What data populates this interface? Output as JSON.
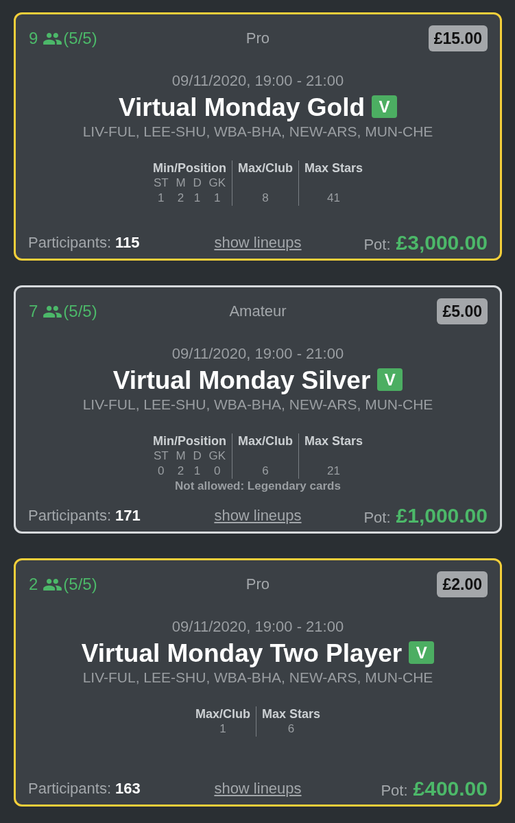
{
  "contests": [
    {
      "color": "#f4cf3a",
      "entries": "9",
      "slots": "(5/5)",
      "tier": "Pro",
      "fee": "£15.00",
      "schedule": "09/11/2020, 19:00 - 21:00",
      "title": "Virtual Monday Gold",
      "badge": "V",
      "fixtures": "LIV-FUL, LEE-SHU, WBA-BHA, NEW-ARS, MUN-CHE",
      "rules": [
        {
          "kind": "positions",
          "heading": "Min/Position",
          "positions": [
            {
              "label": "ST",
              "value": "1"
            },
            {
              "label": "M",
              "value": "2"
            },
            {
              "label": "D",
              "value": "1"
            },
            {
              "label": "GK",
              "value": "1"
            }
          ]
        },
        {
          "kind": "single",
          "heading": "Max/Club",
          "value": "8"
        },
        {
          "kind": "single",
          "heading": "Max Stars",
          "value": "41"
        }
      ],
      "participants_label": "Participants:",
      "participants": "115",
      "link": "show lineups",
      "pot_label": "Pot:",
      "pot": "£3,000.00"
    },
    {
      "color": "#d7dadd",
      "entries": "7",
      "slots": "(5/5)",
      "tier": "Amateur",
      "fee": "£5.00",
      "schedule": "09/11/2020, 19:00 - 21:00",
      "title": "Virtual Monday Silver",
      "badge": "V",
      "fixtures": "LIV-FUL, LEE-SHU, WBA-BHA, NEW-ARS, MUN-CHE",
      "rules": [
        {
          "kind": "positions",
          "heading": "Min/Position",
          "positions": [
            {
              "label": "ST",
              "value": "0"
            },
            {
              "label": "M",
              "value": "2"
            },
            {
              "label": "D",
              "value": "1"
            },
            {
              "label": "GK",
              "value": "0"
            }
          ]
        },
        {
          "kind": "single",
          "heading": "Max/Club",
          "value": "6"
        },
        {
          "kind": "single",
          "heading": "Max Stars",
          "value": "21"
        }
      ],
      "restriction": "Not allowed: Legendary cards",
      "participants_label": "Participants:",
      "participants": "171",
      "link": "show lineups",
      "pot_label": "Pot:",
      "pot": "£1,000.00"
    },
    {
      "color": "#f4cf3a",
      "entries": "2",
      "slots": "(5/5)",
      "tier": "Pro",
      "fee": "£2.00",
      "schedule": "09/11/2020, 19:00 - 21:00",
      "title": "Virtual Monday Two Player",
      "badge": "V",
      "fixtures": "LIV-FUL, LEE-SHU, WBA-BHA, NEW-ARS, MUN-CHE",
      "rules": [
        {
          "kind": "single",
          "heading": "Max/Club",
          "value": "1"
        },
        {
          "kind": "single",
          "heading": "Max Stars",
          "value": "6"
        }
      ],
      "participants_label": "Participants:",
      "participants": "163",
      "link": "show lineups",
      "pot_label": "Pot:",
      "pot": "£400.00"
    }
  ]
}
